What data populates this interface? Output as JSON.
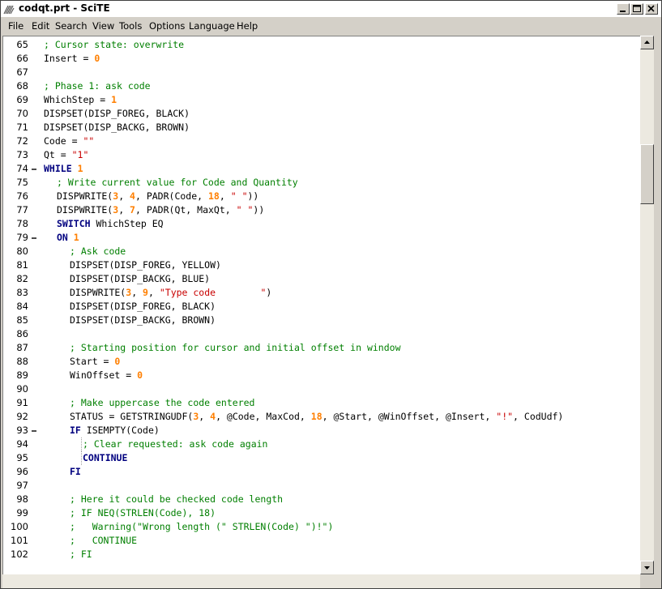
{
  "window": {
    "title": "codqt.prt - SciTE",
    "controls": [
      "minimize",
      "maximize",
      "close"
    ]
  },
  "menubar": {
    "items": [
      "File",
      "Edit",
      "Search",
      "View",
      "Tools",
      "Options",
      "Language",
      "Help"
    ]
  },
  "editor": {
    "lines": [
      {
        "num": "65",
        "indent": 0,
        "fold": "",
        "tokens": [
          [
            "comment",
            "; Cursor state: overwrite"
          ]
        ]
      },
      {
        "num": "66",
        "indent": 0,
        "fold": "",
        "tokens": [
          [
            "text",
            "Insert = "
          ],
          [
            "number",
            "0"
          ]
        ]
      },
      {
        "num": "67",
        "indent": 0,
        "fold": "",
        "tokens": []
      },
      {
        "num": "68",
        "indent": 0,
        "fold": "",
        "tokens": [
          [
            "comment",
            "; Phase 1: ask code"
          ]
        ]
      },
      {
        "num": "69",
        "indent": 0,
        "fold": "",
        "tokens": [
          [
            "text",
            "WhichStep = "
          ],
          [
            "number",
            "1"
          ]
        ]
      },
      {
        "num": "70",
        "indent": 0,
        "fold": "",
        "tokens": [
          [
            "text",
            "DISPSET(DISP_FOREG, BLACK)"
          ]
        ]
      },
      {
        "num": "71",
        "indent": 0,
        "fold": "",
        "tokens": [
          [
            "text",
            "DISPSET(DISP_BACKG, BROWN)"
          ]
        ]
      },
      {
        "num": "72",
        "indent": 0,
        "fold": "",
        "tokens": [
          [
            "text",
            "Code = "
          ],
          [
            "string",
            "\"\""
          ]
        ]
      },
      {
        "num": "73",
        "indent": 0,
        "fold": "",
        "tokens": [
          [
            "text",
            "Qt = "
          ],
          [
            "string",
            "\"1\""
          ]
        ]
      },
      {
        "num": "74",
        "indent": 0,
        "fold": "open",
        "tokens": [
          [
            "keyword",
            "WHILE"
          ],
          [
            "text",
            " "
          ],
          [
            "number",
            "1"
          ]
        ]
      },
      {
        "num": "75",
        "indent": 1,
        "fold": "",
        "tokens": [
          [
            "comment",
            "; Write current value for Code and Quantity"
          ]
        ]
      },
      {
        "num": "76",
        "indent": 1,
        "fold": "",
        "tokens": [
          [
            "text",
            "DISPWRITE("
          ],
          [
            "number",
            "3"
          ],
          [
            "text",
            ", "
          ],
          [
            "number",
            "4"
          ],
          [
            "text",
            ", PADR(Code, "
          ],
          [
            "number",
            "18"
          ],
          [
            "text",
            ", "
          ],
          [
            "string",
            "\" \""
          ],
          [
            "text",
            "))"
          ]
        ]
      },
      {
        "num": "77",
        "indent": 1,
        "fold": "",
        "tokens": [
          [
            "text",
            "DISPWRITE("
          ],
          [
            "number",
            "3"
          ],
          [
            "text",
            ", "
          ],
          [
            "number",
            "7"
          ],
          [
            "text",
            ", PADR(Qt, MaxQt, "
          ],
          [
            "string",
            "\" \""
          ],
          [
            "text",
            "))"
          ]
        ]
      },
      {
        "num": "78",
        "indent": 1,
        "fold": "",
        "tokens": [
          [
            "keyword",
            "SWITCH"
          ],
          [
            "text",
            " WhichStep EQ"
          ]
        ]
      },
      {
        "num": "79",
        "indent": 1,
        "fold": "open",
        "tokens": [
          [
            "keyword",
            "ON"
          ],
          [
            "text",
            " "
          ],
          [
            "number",
            "1"
          ]
        ]
      },
      {
        "num": "80",
        "indent": 2,
        "fold": "",
        "tokens": [
          [
            "comment",
            "; Ask code"
          ]
        ]
      },
      {
        "num": "81",
        "indent": 2,
        "fold": "",
        "tokens": [
          [
            "text",
            "DISPSET(DISP_FOREG, YELLOW)"
          ]
        ]
      },
      {
        "num": "82",
        "indent": 2,
        "fold": "",
        "tokens": [
          [
            "text",
            "DISPSET(DISP_BACKG, BLUE)"
          ]
        ]
      },
      {
        "num": "83",
        "indent": 2,
        "fold": "",
        "tokens": [
          [
            "text",
            "DISPWRITE("
          ],
          [
            "number",
            "3"
          ],
          [
            "text",
            ", "
          ],
          [
            "number",
            "9"
          ],
          [
            "text",
            ", "
          ],
          [
            "string",
            "\"Type code        \""
          ],
          [
            "text",
            ")"
          ]
        ]
      },
      {
        "num": "84",
        "indent": 2,
        "fold": "",
        "tokens": [
          [
            "text",
            "DISPSET(DISP_FOREG, BLACK)"
          ]
        ]
      },
      {
        "num": "85",
        "indent": 2,
        "fold": "",
        "tokens": [
          [
            "text",
            "DISPSET(DISP_BACKG, BROWN)"
          ]
        ]
      },
      {
        "num": "86",
        "indent": 0,
        "fold": "",
        "tokens": []
      },
      {
        "num": "87",
        "indent": 2,
        "fold": "",
        "tokens": [
          [
            "comment",
            "; Starting position for cursor and initial offset in window"
          ]
        ]
      },
      {
        "num": "88",
        "indent": 2,
        "fold": "",
        "tokens": [
          [
            "text",
            "Start = "
          ],
          [
            "number",
            "0"
          ]
        ]
      },
      {
        "num": "89",
        "indent": 2,
        "fold": "",
        "tokens": [
          [
            "text",
            "WinOffset = "
          ],
          [
            "number",
            "0"
          ]
        ]
      },
      {
        "num": "90",
        "indent": 0,
        "fold": "",
        "tokens": []
      },
      {
        "num": "91",
        "indent": 2,
        "fold": "",
        "tokens": [
          [
            "comment",
            "; Make uppercase the code entered"
          ]
        ]
      },
      {
        "num": "92",
        "indent": 2,
        "fold": "",
        "tokens": [
          [
            "text",
            "STATUS = GETSTRINGUDF("
          ],
          [
            "number",
            "3"
          ],
          [
            "text",
            ", "
          ],
          [
            "number",
            "4"
          ],
          [
            "text",
            ", @Code, MaxCod, "
          ],
          [
            "number",
            "18"
          ],
          [
            "text",
            ", @Start, @WinOffset, @Insert, "
          ],
          [
            "string",
            "\"!\""
          ],
          [
            "text",
            ", CodUdf)"
          ]
        ]
      },
      {
        "num": "93",
        "indent": 2,
        "fold": "open",
        "tokens": [
          [
            "keyword",
            "IF"
          ],
          [
            "text",
            " ISEMPTY(Code)"
          ]
        ]
      },
      {
        "num": "94",
        "indent": 3,
        "fold": "",
        "tokens": [
          [
            "comment",
            "; Clear requested: ask code again"
          ]
        ]
      },
      {
        "num": "95",
        "indent": 3,
        "fold": "",
        "tokens": [
          [
            "keyword",
            "CONTINUE"
          ]
        ]
      },
      {
        "num": "96",
        "indent": 2,
        "fold": "",
        "tokens": [
          [
            "keyword",
            "FI"
          ]
        ]
      },
      {
        "num": "97",
        "indent": 0,
        "fold": "",
        "tokens": []
      },
      {
        "num": "98",
        "indent": 2,
        "fold": "",
        "tokens": [
          [
            "comment",
            "; Here it could be checked code length"
          ]
        ]
      },
      {
        "num": "99",
        "indent": 2,
        "fold": "",
        "tokens": [
          [
            "comment",
            "; IF NEQ(STRLEN(Code), 18)"
          ]
        ]
      },
      {
        "num": "100",
        "indent": 2,
        "fold": "",
        "tokens": [
          [
            "comment",
            ";   Warning(\"Wrong length (\" STRLEN(Code) \")!\")"
          ]
        ]
      },
      {
        "num": "101",
        "indent": 2,
        "fold": "",
        "tokens": [
          [
            "comment",
            ";   CONTINUE"
          ]
        ]
      },
      {
        "num": "102",
        "indent": 2,
        "fold": "",
        "tokens": [
          [
            "comment",
            "; FI"
          ]
        ]
      }
    ]
  },
  "scrollbar": {
    "vertical_position": 0.21
  }
}
